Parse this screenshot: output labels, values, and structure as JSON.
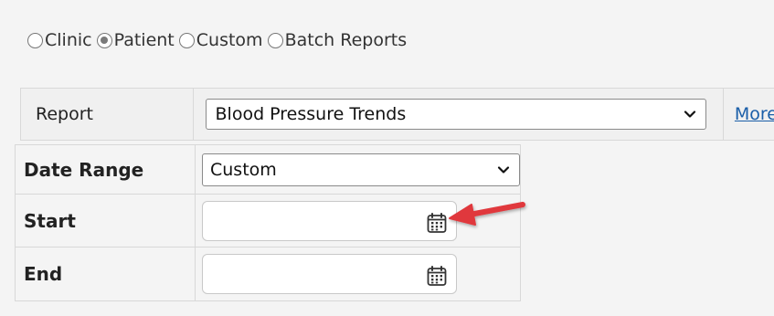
{
  "report_type": {
    "options": [
      "Clinic",
      "Patient",
      "Custom",
      "Batch Reports"
    ],
    "selected": "Patient"
  },
  "report": {
    "label": "Report",
    "selected_value": "Blood Pressure Trends",
    "more_link": "More"
  },
  "date_range": {
    "label": "Date Range",
    "selected_value": "Custom"
  },
  "start": {
    "label": "Start",
    "value": "",
    "icon": "calendar-icon"
  },
  "end": {
    "label": "End",
    "value": "",
    "icon": "calendar-icon"
  },
  "annotation": {
    "arrow_color": "#e0383c",
    "points_to": "start-calendar-icon"
  },
  "colors": {
    "link": "#1a5ea8",
    "background": "#f4f4f4",
    "border": "#d8d8d8"
  }
}
